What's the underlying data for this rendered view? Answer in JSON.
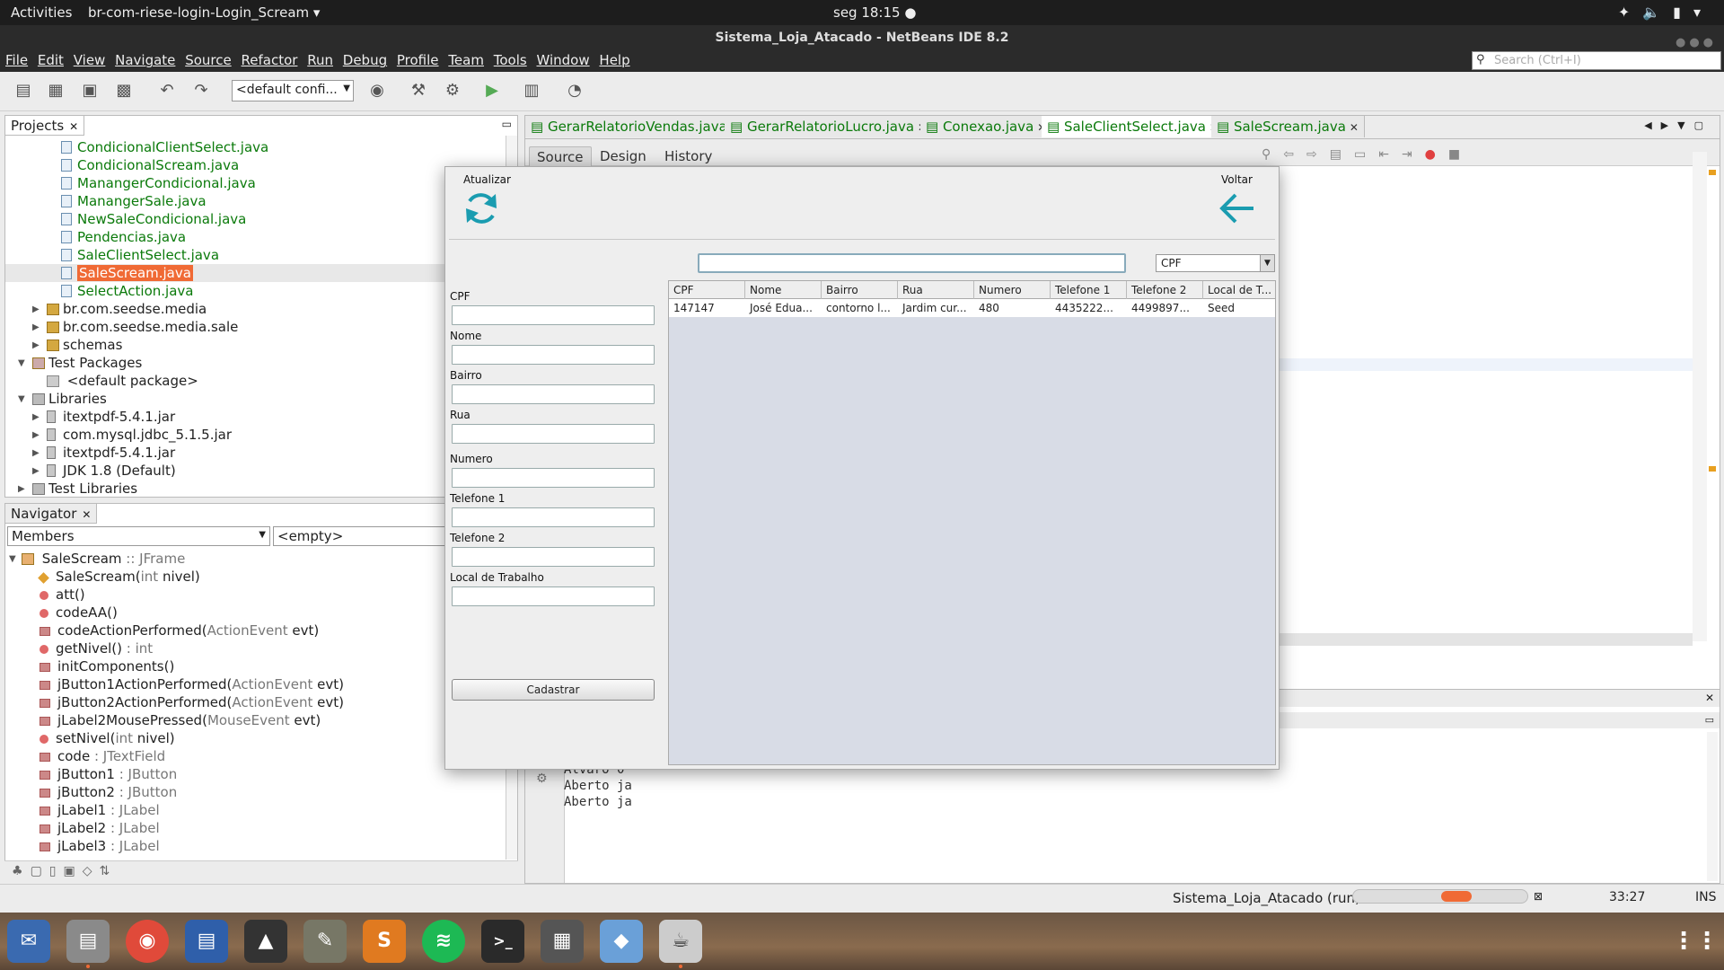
{
  "topbar": {
    "activities": "Activities",
    "app_menu": "br-com-riese-login-Login_Scream ▾",
    "clock": "seg 18:15 ●"
  },
  "window": {
    "title": "Sistema_Loja_Atacado - NetBeans IDE 8.2"
  },
  "menu": [
    "File",
    "Edit",
    "View",
    "Navigate",
    "Source",
    "Refactor",
    "Run",
    "Debug",
    "Profile",
    "Team",
    "Tools",
    "Window",
    "Help"
  ],
  "search": {
    "placeholder": "Search (Ctrl+I)"
  },
  "toolbar": {
    "config": "<default confi..."
  },
  "projects": {
    "tab": "Projects",
    "files": [
      "CondicionalClientSelect.java",
      "CondicionalScream.java",
      "ManangerCondicional.java",
      "ManangerSale.java",
      "NewSaleCondicional.java",
      "Pendencias.java",
      "SaleClientSelect.java",
      "SaleScream.java",
      "SelectAction.java"
    ],
    "packages": [
      "br.com.seedse.media",
      "br.com.seedse.media.sale",
      "schemas"
    ],
    "test_packages": "Test Packages",
    "default_package": "<default package>",
    "libraries": "Libraries",
    "jars": [
      "itextpdf-5.4.1.jar",
      "com.mysql.jdbc_5.1.5.jar",
      "itextpdf-5.4.1.jar",
      "JDK 1.8 (Default)"
    ],
    "test_libraries": "Test Libraries"
  },
  "navigator": {
    "tab": "Navigator",
    "members": "Members",
    "empty": "<empty>",
    "root": {
      "name": "SaleScream",
      "type": " :: JFrame"
    },
    "items": [
      {
        "name": "SaleScream(",
        "type": "int",
        "rest": " nivel)"
      },
      {
        "name": "att()",
        "type": "",
        "rest": ""
      },
      {
        "name": "codeAA()",
        "type": "",
        "rest": ""
      },
      {
        "name": "codeActionPerformed(",
        "type": "ActionEvent",
        "rest": " evt)"
      },
      {
        "name": "getNivel()",
        "type": " : int",
        "rest": ""
      },
      {
        "name": "initComponents()",
        "type": "",
        "rest": ""
      },
      {
        "name": "jButton1ActionPerformed(",
        "type": "ActionEvent",
        "rest": " evt)"
      },
      {
        "name": "jButton2ActionPerformed(",
        "type": "ActionEvent",
        "rest": " evt)"
      },
      {
        "name": "jLabel2MousePressed(",
        "type": "MouseEvent",
        "rest": " evt)"
      },
      {
        "name": "setNivel(",
        "type": "int",
        "rest": " nivel)"
      },
      {
        "name": "code",
        "type": " : JTextField",
        "rest": ""
      },
      {
        "name": "jButton1",
        "type": " : JButton",
        "rest": ""
      },
      {
        "name": "jButton2",
        "type": " : JButton",
        "rest": ""
      },
      {
        "name": "jLabel1",
        "type": " : JLabel",
        "rest": ""
      },
      {
        "name": "jLabel2",
        "type": " : JLabel",
        "rest": ""
      },
      {
        "name": "jLabel3",
        "type": " : JLabel",
        "rest": ""
      }
    ]
  },
  "editor": {
    "tabs": [
      "GerarRelatorioVendas.java",
      "GerarRelatorioLucro.java",
      "Conexao.java",
      "SaleClientSelect.java",
      "SaleScream.java"
    ],
    "subtabs": [
      "Source",
      "Design",
      "History"
    ]
  },
  "output": {
    "lines": [
      "Alvaro  0",
      "Aberto ja",
      "Aberto ja"
    ]
  },
  "status": {
    "run": "Sistema_Loja_Atacado (run)",
    "position": "33:27",
    "mode": "INS",
    "progress": 0.5
  },
  "dialog": {
    "atualizar": "Atualizar",
    "voltar": "Voltar",
    "labels": [
      "CPF",
      "Nome",
      "Bairro",
      "Rua",
      "Numero",
      "Telefone 1",
      "Telefone 2",
      "Local de Trabalho"
    ],
    "cadastrar": "Cadastrar",
    "search_value": "",
    "combo": "CPF",
    "columns": [
      "CPF",
      "Nome",
      "Bairro",
      "Rua",
      "Numero",
      "Telefone 1",
      "Telefone 2",
      "Local de T..."
    ],
    "row": [
      "147147",
      "José Edua...",
      "contorno l...",
      "Jardim cur...",
      "480",
      "4435222...",
      "4499897...",
      "Seed"
    ]
  },
  "colors": {
    "accent": "#f06a35",
    "teal_icon": "#1a9cb0",
    "java_green": "#0b7a0b"
  }
}
